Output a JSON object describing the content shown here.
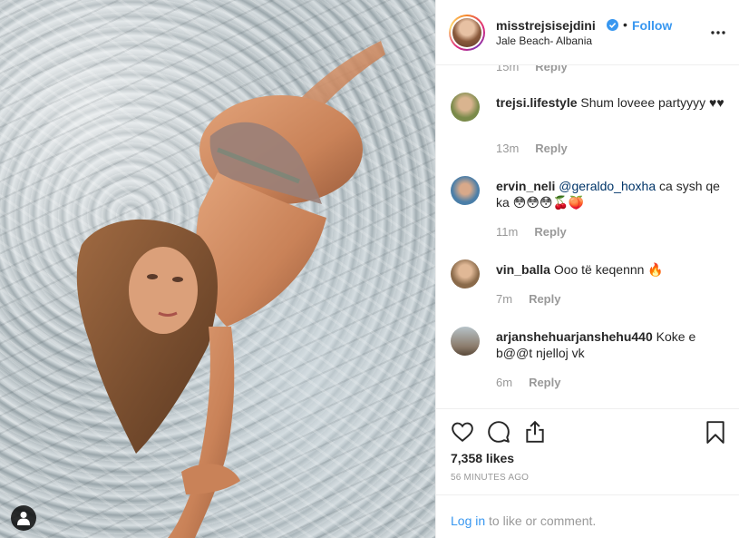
{
  "post": {
    "username": "misstrejsisejdini",
    "location": "Jale Beach- Albania",
    "follow_label": "Follow",
    "dot": "•",
    "likes": "7,358 likes",
    "time_ago": "56 MINUTES AGO"
  },
  "previous_comment": {
    "time": "15m",
    "reply": "Reply"
  },
  "comments": [
    {
      "user": "trejsi.lifestyle",
      "text": "Shum loveee partyyyy ♥♥",
      "mention": "",
      "time": "13m",
      "reply": "Reply",
      "avatar_color": "#7a8a4a"
    },
    {
      "user": "ervin_neli",
      "mention": "@geraldo_hoxha",
      "text": "ca sysh qe ka 😳😳😳🍒🍑",
      "time": "11m",
      "reply": "Reply",
      "avatar_color": "#4a7ea8"
    },
    {
      "user": "vin_balla",
      "mention": "",
      "text": "Ooo të keqennn 🔥",
      "time": "7m",
      "reply": "Reply",
      "avatar_color": "#8a6a4a"
    },
    {
      "user": "arjanshehuarjanshehu440",
      "mention": "",
      "text": "Koke e b@@t njelloj vk",
      "time": "6m",
      "reply": "Reply",
      "avatar_color": "#8a7a6a"
    }
  ],
  "login": {
    "link": "Log in",
    "rest": " to like or comment."
  },
  "icons": {
    "like": "heart-icon",
    "comment": "comment-icon",
    "share": "share-icon",
    "save": "bookmark-icon",
    "more": "more-options-icon",
    "verified": "verified-badge-icon",
    "user_tag": "user-tag-icon"
  },
  "colors": {
    "link": "#3897f0",
    "muted": "#999999",
    "text": "#262626"
  }
}
